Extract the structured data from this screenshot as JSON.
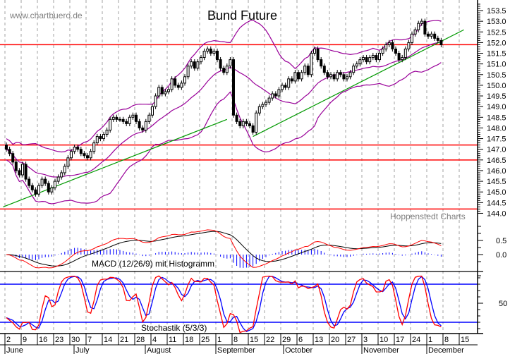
{
  "header": {
    "watermark": "www.chartbuero.de",
    "title": "Bund Future",
    "credit": "Hoppenstedt Charts"
  },
  "chart_data": {
    "type": "candlestick",
    "title": "Bund Future",
    "price_axis": {
      "ticks": [
        "153.5",
        "153.0",
        "152.5",
        "152.0",
        "151.5",
        "151.0",
        "150.5",
        "150.0",
        "149.5",
        "149.0",
        "148.5",
        "148.0",
        "147.5",
        "147.0",
        "146.5",
        "146.0",
        "145.5",
        "145.0",
        "144.5",
        "144.0"
      ],
      "range": [
        144.0,
        153.5
      ]
    },
    "weeks": [
      {
        "label": "2",
        "closes": [
          147.0,
          146.8,
          146.4,
          146.0,
          145.8
        ]
      },
      {
        "label": "9",
        "closes": [
          146.3,
          145.6,
          145.3,
          145.1,
          144.9
        ]
      },
      {
        "label": "16",
        "closes": [
          145.3,
          145.6,
          145.4,
          145.0,
          145.2
        ]
      },
      {
        "label": "23",
        "closes": [
          145.5,
          145.7,
          145.9,
          146.2,
          146.6
        ]
      },
      {
        "label": "30",
        "closes": [
          146.9,
          147.1,
          147.0,
          146.8,
          146.7
        ]
      },
      {
        "label": "7",
        "closes": [
          146.6,
          146.9,
          147.3,
          147.6,
          147.5
        ]
      },
      {
        "label": "14",
        "closes": [
          147.7,
          147.9,
          148.4,
          148.5,
          148.4
        ]
      },
      {
        "label": "21",
        "closes": [
          148.4,
          148.3,
          148.2,
          148.5,
          148.6
        ]
      },
      {
        "label": "28",
        "closes": [
          148.3,
          148.0,
          147.9,
          148.3,
          148.6
        ]
      },
      {
        "label": "4",
        "closes": [
          149.0,
          149.5,
          149.9,
          149.6,
          149.7
        ]
      },
      {
        "label": "11",
        "closes": [
          149.8,
          150.3,
          150.0,
          149.9,
          150.1
        ]
      },
      {
        "label": "18",
        "closes": [
          150.4,
          150.9,
          151.1,
          150.8,
          151.1
        ]
      },
      {
        "label": "25",
        "closes": [
          151.3,
          151.6,
          151.7,
          151.5,
          151.6
        ]
      },
      {
        "label": "1",
        "closes": [
          151.2,
          150.8,
          150.6,
          150.9,
          151.2
        ]
      },
      {
        "label": "8",
        "closes": [
          148.6,
          148.3,
          148.1,
          148.3,
          148.2
        ]
      },
      {
        "label": "15",
        "closes": [
          148.1,
          147.8,
          148.7,
          149.0,
          149.1
        ]
      },
      {
        "label": "22",
        "closes": [
          149.2,
          149.4,
          149.6,
          149.5,
          149.8
        ]
      },
      {
        "label": "29",
        "closes": [
          150.0,
          149.9,
          150.3,
          150.2,
          150.6
        ]
      },
      {
        "label": "6",
        "closes": [
          150.3,
          150.6,
          150.9,
          150.5,
          151.5
        ]
      },
      {
        "label": "13",
        "closes": [
          151.7,
          151.2,
          150.9,
          150.6,
          150.4
        ]
      },
      {
        "label": "20",
        "closes": [
          150.5,
          150.3,
          150.6,
          150.5,
          150.3
        ]
      },
      {
        "label": "27",
        "closes": [
          150.4,
          150.6,
          150.9,
          151.0,
          151.2
        ]
      },
      {
        "label": "3",
        "closes": [
          151.3,
          151.1,
          151.3,
          151.4,
          151.2
        ]
      },
      {
        "label": "10",
        "closes": [
          151.5,
          151.7,
          151.9,
          152.0,
          151.7
        ]
      },
      {
        "label": "17",
        "closes": [
          151.5,
          151.2,
          151.3,
          151.7,
          152.0
        ]
      },
      {
        "label": "24",
        "closes": [
          152.4,
          152.6,
          152.9,
          153.0,
          152.4
        ]
      },
      {
        "label": "1",
        "closes": [
          152.3,
          152.4,
          152.2,
          152.1,
          151.9
        ]
      },
      {
        "label": "8",
        "closes": []
      },
      {
        "label": "15",
        "closes": []
      }
    ],
    "months": [
      {
        "label": "June",
        "week": 0
      },
      {
        "label": "July",
        "week": 4
      },
      {
        "label": "August",
        "week": 8
      },
      {
        "label": "September",
        "week": 13
      },
      {
        "label": "October",
        "week": 17
      },
      {
        "label": "November",
        "week": 22
      },
      {
        "label": "December",
        "week": 26
      }
    ],
    "horizontal_lines": [
      151.9,
      147.2,
      146.5,
      144.2
    ],
    "trend_lines": [
      {
        "start": {
          "date": "May 30",
          "value": 144.3
        },
        "end": {
          "date": "Sep 4",
          "value": 148.4
        }
      },
      {
        "start": {
          "date": "Sep 16",
          "value": 147.6
        },
        "end": {
          "date": "Dec 16",
          "value": 152.6
        }
      }
    ],
    "bollinger_bands": true,
    "colors": {
      "bands": "#990099",
      "levels": "#ff0000",
      "trend": "#009900",
      "candle": "#000000",
      "macd": "#ff0000",
      "signal": "#000000",
      "histogram": "#0000ff",
      "stoch_k": "#ff0000",
      "stoch_d": "#0000ff",
      "stoch_levels": "#0000ff",
      "grid": "#a0a0a0"
    },
    "macd": {
      "label": "MACD (12/26/9) mit Histogramm",
      "ticks": [
        "0.5",
        "0.0"
      ]
    },
    "stochastic": {
      "label": "Stochastik (5/3/3)",
      "ticks": [
        "50"
      ],
      "levels": [
        80,
        20
      ]
    }
  }
}
